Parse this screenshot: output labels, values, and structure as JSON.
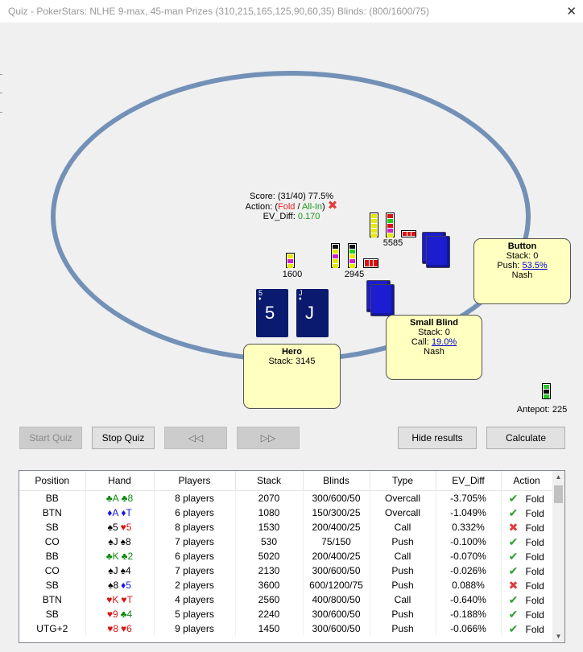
{
  "window": {
    "title": "Quiz - PokerStars: NLHE 9-max, 45-man Prizes (310,215,165,125,90,60,35) Blinds: (800/1600/75)",
    "close_glyph": "✕"
  },
  "quiz": {
    "score_label": "Score:",
    "score_value": "(31/40) 77.5%",
    "action_label": "Action:",
    "open_paren": "(",
    "fold": "Fold",
    "slash": " / ",
    "allin": "All-In",
    "close_paren": ")",
    "wrong_mark": "✖",
    "ev_label": "EV_Diff:",
    "ev_value": "0.170"
  },
  "chips": {
    "pot1": "1600",
    "pot2": "2945",
    "pot3": "5585",
    "antepot": "Antepot: 225"
  },
  "hero": {
    "name": "Hero",
    "stack": "Stack: 3145",
    "cards": [
      {
        "rank": "5",
        "suit": "♦"
      },
      {
        "rank": "J",
        "suit": "♦"
      }
    ]
  },
  "button_seat": {
    "name": "Button",
    "stack": "Stack: 0",
    "push_label": "Push:",
    "push_value": "53.5%",
    "strategy": "Nash"
  },
  "small_blind_seat": {
    "name": "Small Blind",
    "stack": "Stack: 0",
    "call_label": "Call:",
    "call_value": "19.0%",
    "strategy": "Nash"
  },
  "buttons": {
    "start_quiz": "Start Quiz",
    "stop_quiz": "Stop Quiz",
    "prev": "◁◁",
    "next": "▷▷",
    "hide_results": "Hide results",
    "calculate": "Calculate"
  },
  "colors": {
    "table_ring": "#7391b7",
    "seat_fill": "#ffffc0",
    "card_back": "#0a1a6e",
    "deck": "#1c1cd0"
  },
  "results": {
    "columns": [
      "Position",
      "Hand",
      "Players",
      "Stack",
      "Blinds",
      "Type",
      "EV_Diff",
      "Action"
    ],
    "rows": [
      {
        "pos": "BB",
        "h1": "♣A",
        "c1": "#118811",
        "h2": "♣8",
        "c2": "#118811",
        "players": "8 players",
        "stack": "2070",
        "blinds": "300/600/50",
        "type": "Overcall",
        "ev": "-3.705%",
        "ok": true,
        "action": "Fold"
      },
      {
        "pos": "BTN",
        "h1": "♦A",
        "c1": "#1515e6",
        "h2": "♦T",
        "c2": "#1515e6",
        "players": "6 players",
        "stack": "1080",
        "blinds": "150/300/25",
        "type": "Overcall",
        "ev": "-1.049%",
        "ok": true,
        "action": "Fold"
      },
      {
        "pos": "SB",
        "h1": "♠5",
        "c1": "#000000",
        "h2": "♥5",
        "c2": "#dd1111",
        "players": "8 players",
        "stack": "1530",
        "blinds": "200/400/25",
        "type": "Call",
        "ev": "0.332%",
        "ok": false,
        "action": "Fold"
      },
      {
        "pos": "CO",
        "h1": "♠J",
        "c1": "#000000",
        "h2": "♠8",
        "c2": "#000000",
        "players": "7 players",
        "stack": "530",
        "blinds": "75/150",
        "type": "Push",
        "ev": "-0.100%",
        "ok": true,
        "action": "Fold"
      },
      {
        "pos": "BB",
        "h1": "♣K",
        "c1": "#118811",
        "h2": "♣2",
        "c2": "#118811",
        "players": "6 players",
        "stack": "5020",
        "blinds": "200/400/25",
        "type": "Call",
        "ev": "-0.070%",
        "ok": true,
        "action": "Fold"
      },
      {
        "pos": "CO",
        "h1": "♠J",
        "c1": "#000000",
        "h2": "♠4",
        "c2": "#000000",
        "players": "7 players",
        "stack": "2130",
        "blinds": "300/600/50",
        "type": "Push",
        "ev": "-0.026%",
        "ok": true,
        "action": "Fold"
      },
      {
        "pos": "SB",
        "h1": "♠8",
        "c1": "#000000",
        "h2": "♦5",
        "c2": "#1515e6",
        "players": "2 players",
        "stack": "3600",
        "blinds": "600/1200/75",
        "type": "Push",
        "ev": "0.088%",
        "ok": false,
        "action": "Fold"
      },
      {
        "pos": "BTN",
        "h1": "♥K",
        "c1": "#dd1111",
        "h2": "♥T",
        "c2": "#dd1111",
        "players": "4 players",
        "stack": "2560",
        "blinds": "400/800/50",
        "type": "Call",
        "ev": "-0.640%",
        "ok": true,
        "action": "Fold"
      },
      {
        "pos": "SB",
        "h1": "♥9",
        "c1": "#dd1111",
        "h2": "♣4",
        "c2": "#118811",
        "players": "5 players",
        "stack": "2240",
        "blinds": "300/600/50",
        "type": "Push",
        "ev": "-0.188%",
        "ok": true,
        "action": "Fold"
      },
      {
        "pos": "UTG+2",
        "h1": "♥8",
        "c1": "#dd1111",
        "h2": "♥6",
        "c2": "#dd1111",
        "players": "9 players",
        "stack": "1450",
        "blinds": "300/600/50",
        "type": "Push",
        "ev": "-0.066%",
        "ok": true,
        "action": "Fold"
      }
    ]
  }
}
